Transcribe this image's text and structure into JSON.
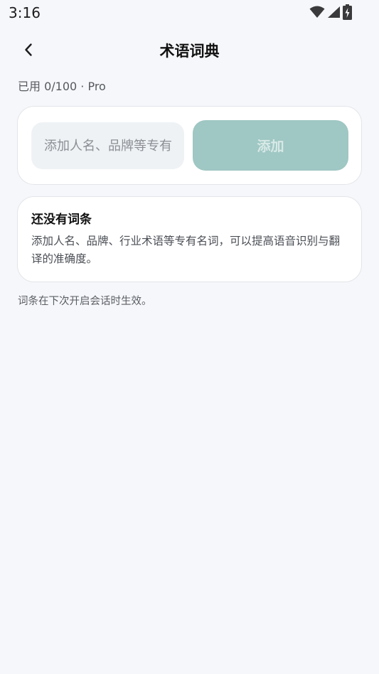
{
  "status_bar": {
    "time": "3:16",
    "icons": [
      "wifi-icon",
      "signal-icon",
      "battery-charging-icon"
    ]
  },
  "header": {
    "back_icon": "chevron-left-icon",
    "title": "术语词典"
  },
  "usage": {
    "text": "已用 0/100 · Pro"
  },
  "add_form": {
    "input_value": "",
    "input_placeholder": "添加人名、品牌等专有名词",
    "add_label": "添加"
  },
  "empty_state": {
    "title": "还没有词条",
    "description": "添加人名、品牌、行业术语等专有名词，可以提高语音识别与翻译的准确度。"
  },
  "footnote": "词条在下次开启会话时生效。",
  "colors": {
    "background": "#f6f7fa",
    "accent_disabled": "#9fc7c3",
    "card": "#ffffff"
  }
}
